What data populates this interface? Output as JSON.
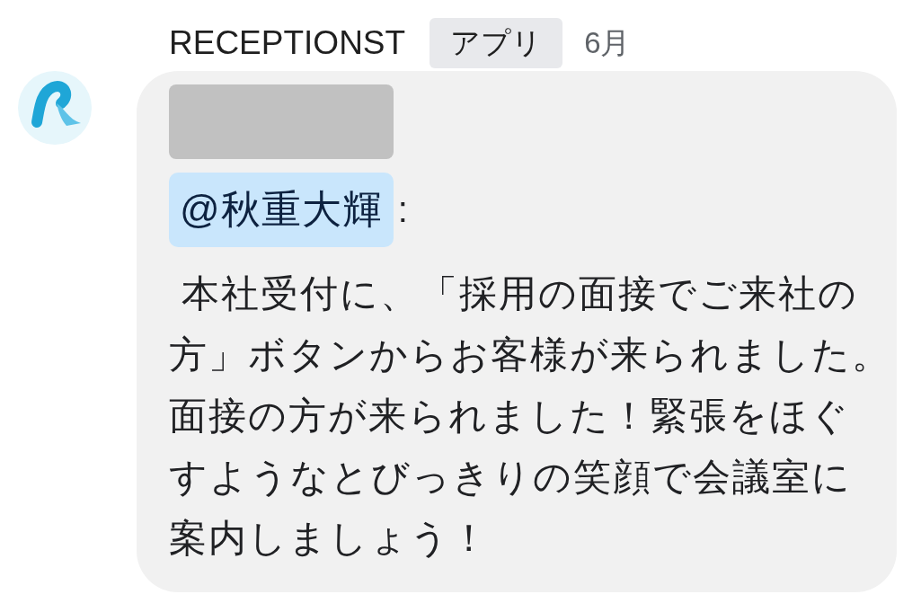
{
  "message": {
    "sender": "RECEPTIONST",
    "badge": "アプリ",
    "time": "6月",
    "mention": "@秋重大輝",
    "after_mention": ":",
    "body_lines": [
      " 本社受付に、「採用の面接でご来社の",
      "方」ボタンからお客様が来られました。",
      "面接の方が来られました！緊張をほぐ",
      "すようなとびっきりの笑顔で会議室に",
      "案内しましょう！"
    ]
  }
}
